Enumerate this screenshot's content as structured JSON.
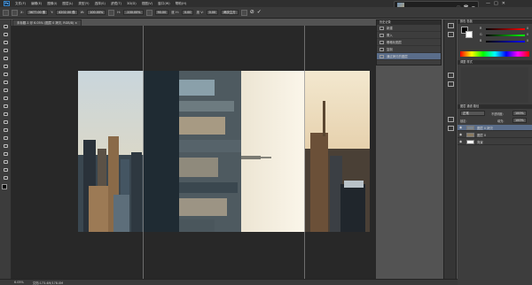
{
  "menubar": {
    "logo": "Ps",
    "items": [
      "文件(F)",
      "编辑(E)",
      "图像(I)",
      "图层(L)",
      "类型(Y)",
      "选择(S)",
      "滤镜(T)",
      "3D(D)",
      "视图(V)",
      "窗口(W)",
      "帮助(H)"
    ]
  },
  "options": {
    "x_label": "X:",
    "x_value": "3677.00 像",
    "y_label": "Y:",
    "y_value": "4202.00 像",
    "w_label": "W:",
    "w_value": "100.00%",
    "h_label": "H:",
    "h_value": "-100.00%",
    "angle_value": "90.00",
    "skew_label": "度 H:",
    "skew_value": "0.00",
    "v_label": "度 V:",
    "v_value": "0.00",
    "interp": "两次立方",
    "cancel": "⊘",
    "commit": "✓"
  },
  "doc_tab": "未标题-1 @ 6.05% (图层 0 拷贝, RGB/8) ×",
  "status": {
    "zoom": "6.05%",
    "doc_info": "文档:173.4M/178.0M"
  },
  "notification": {
    "text": "ou always call me everyday",
    "heart": "♡",
    "trash": "🗑",
    "menu": "≡"
  },
  "window_controls": [
    "—",
    "□",
    "✕"
  ],
  "history": {
    "title": "历史记录",
    "rows": [
      {
        "label": "新建"
      },
      {
        "label": "置入"
      },
      {
        "label": "栅格化图层"
      },
      {
        "label": "复制"
      },
      {
        "label": "通过拷贝的图层"
      }
    ],
    "active_index": 4
  },
  "color_panel": {
    "title": "颜色  色板",
    "channels": [
      {
        "label": "R",
        "value": "0",
        "color": "#ff3b3b"
      },
      {
        "label": "G",
        "value": "0",
        "color": "#3bd13b"
      },
      {
        "label": "B",
        "value": "0",
        "color": "#3b6bff"
      }
    ]
  },
  "adjust_panel": {
    "title": "调整  样式"
  },
  "layers_panel": {
    "title": "图层  通道  路径",
    "blend_mode": "正常",
    "opacity_label": "不透明度:",
    "opacity_value": "100%",
    "lock_label": "锁定:",
    "fill_label": "填充:",
    "fill_value": "100%",
    "layers": [
      {
        "name": "图层 0 拷贝",
        "selected": true
      },
      {
        "name": "图层 0",
        "selected": false
      },
      {
        "name": "背景",
        "selected": false
      }
    ]
  },
  "colors": {
    "ui_dark": "#282828",
    "panel": "#3d3d3d",
    "selection": "#5a6d8a",
    "foreground": "#000000",
    "background": "#ffffff"
  }
}
